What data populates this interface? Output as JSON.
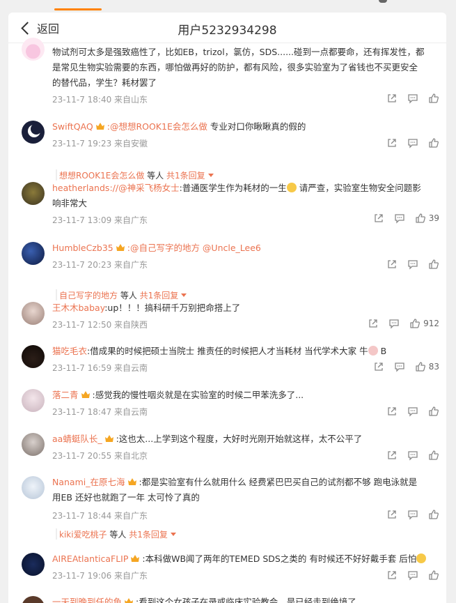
{
  "header": {
    "back_label": "返回",
    "title": "用户5232934298"
  },
  "comments": [
    {
      "line1": "物试剂可太多是强致癌性了，比如EB，trizol，氯仿，SDS......碰到一点都要命，还有挥发性，都",
      "line2": "是常见生物实验需要的东西，哪怕做再好的防护，都有风险，很多实验室为了省钱也不买更安全",
      "line3": "的替代品，学生？耗材罢了",
      "time": "23-11-7 18:40 来自山东",
      "likes": ""
    },
    {
      "name": "SwiftQAQ",
      "text_mention": ":@想想ROOK1E会怎么做",
      "text": " 专业对口你瞅瞅真的假的",
      "time": "23-11-7 19:23 来自安徽",
      "likes": "",
      "reply_name": "想想ROOK1E会怎么做",
      "reply_mid": " 等人 ",
      "reply_link": "共1条回复"
    },
    {
      "name": "heatherlands",
      "text_mention": "://@神采飞杨女士",
      "text": ":普通医学生作为耗材的一生",
      "text_tail": " 请严查，实验室生物安全问题影",
      "line2": "响非常大",
      "time": "23-11-7 13:09 来自广东",
      "likes": "39"
    },
    {
      "name": "HumbleCzb35",
      "text_mention": ":@自己写字的地方 @Uncle_Lee6",
      "time": "23-11-7 20:23 来自广东",
      "likes": "",
      "reply_name": "自己写字的地方",
      "reply_mid": " 等人 ",
      "reply_link": "共1条回复"
    },
    {
      "name": "王木木babay",
      "text": ":up！！！搞科研千万别把命搭上了",
      "time": "23-11-7 12:50 来自陕西",
      "likes": "912"
    },
    {
      "name": "猫吃毛衣",
      "text": ":借成果的时候把硕士当院士 推责任的时候把人才当耗材 当代学术大家  牛",
      "text_tail": " B",
      "time": "23-11-7 16:59 来自云南",
      "likes": "83"
    },
    {
      "name": "落二青",
      "text": ":感觉我的慢性咽炎就是在实验室的时候二甲苯洗多了...",
      "time": "23-11-7 18:47 来自云南",
      "likes": ""
    },
    {
      "name": "aa蜻蜓队长_",
      "text": ":这也太...上学到这个程度，大好时光刚开始就这样，太不公平了",
      "time": "23-11-7 20:55 来自北京",
      "likes": ""
    },
    {
      "name": "Nanami_在原七海",
      "text": ":都是实验室有什么就用什么 经费紧巴巴买自己的试剂都不够 跑电泳就是",
      "line2": "用EB 还好也就跑了一年 太可怜了真的",
      "time": "23-11-7 18:44 来自广东",
      "likes": "",
      "reply_name": "kiki爱吃桃子",
      "reply_mid": " 等人 ",
      "reply_link": "共1条回复"
    },
    {
      "name": "AIREAtlanticaFLIP",
      "text": ":本科做WB闻了两年的TEMED SDS之类的 有时候还不好好戴手套 后怕",
      "time": "23-11-7 19:06 来自广东",
      "likes": ""
    },
    {
      "name": "一天到晚到任的鱼",
      "text": ":看到这个女孩子在录或临床实验教会，是已经走到绝境了",
      "time": "",
      "likes": ""
    }
  ],
  "icons": [
    "share-icon",
    "comment-icon",
    "like-icon",
    "back-chevron-icon",
    "crown-badge-icon"
  ],
  "colors": {
    "accent": "#ff8200",
    "username": "#eb7350",
    "meta": "#999999",
    "background": "#f0f0f0"
  }
}
